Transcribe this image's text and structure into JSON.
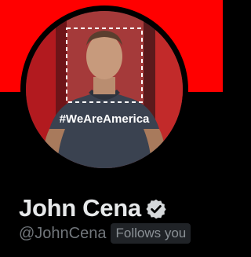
{
  "profile": {
    "display_name": "John Cena",
    "handle": "@JohnCena",
    "follows_you_label": "Follows you",
    "verified_icon": "verified-badge-icon",
    "avatar_caption": "#WeAreAmerica"
  },
  "colors": {
    "banner": "#ff0000",
    "background": "#000000",
    "name_text": "#e7e9ea",
    "handle_text": "#71767b",
    "badge_background": "#202327"
  }
}
